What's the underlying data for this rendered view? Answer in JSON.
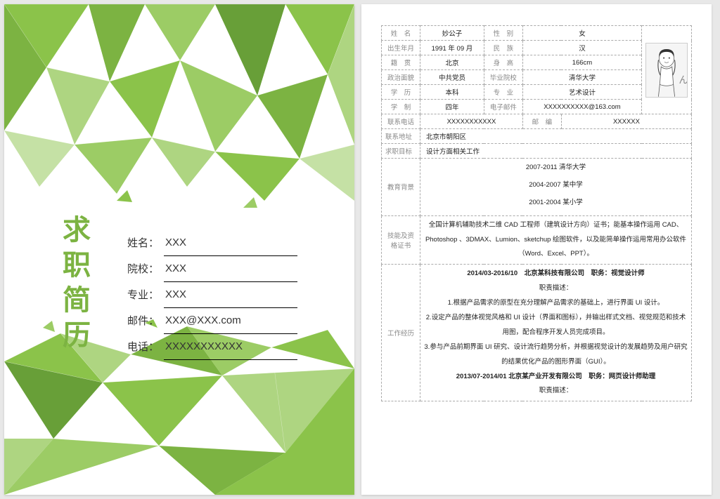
{
  "cover": {
    "title": "求职简历",
    "fields": [
      {
        "label": "姓名：",
        "value": "XXX"
      },
      {
        "label": "院校：",
        "value": "XXX"
      },
      {
        "label": "专业：",
        "value": "XXX"
      },
      {
        "label": "邮件：",
        "value": "XXX@XXX.com"
      },
      {
        "label": "电话：",
        "value": "XXXXXXXXXXX"
      }
    ]
  },
  "resume": {
    "basic": {
      "name_lbl": "姓　名",
      "name": "妙公子",
      "gender_lbl": "性　别",
      "gender": "女",
      "birth_lbl": "出生年月",
      "birth": "1991 年 09 月",
      "ethnic_lbl": "民　族",
      "ethnic": "汉",
      "origin_lbl": "籍　贯",
      "origin": "北京",
      "height_lbl": "身　高",
      "height": "166cm",
      "politics_lbl": "政治面貌",
      "politics": "中共党员",
      "school_lbl": "毕业院校",
      "school": "清华大学",
      "degree_lbl": "学　历",
      "degree": "本科",
      "major_lbl": "专　业",
      "major": "艺术设计",
      "years_lbl": "学　制",
      "years": "四年",
      "email_lbl": "电子邮件",
      "email": "XXXXXXXXXX@163.com",
      "phone_lbl": "联系电话",
      "phone": "XXXXXXXXXXX",
      "post_lbl": "邮　编",
      "post": "XXXXXX",
      "addr_lbl": "联系地址",
      "addr": "北京市朝阳区"
    },
    "objective": {
      "lbl": "求职目标",
      "value": "设计方面相关工作"
    },
    "education": {
      "lbl": "教育背景",
      "items": [
        "2007-2011 清华大学",
        "2004-2007 某中学",
        "2001-2004 某小学"
      ]
    },
    "skills": {
      "lbl1": "技能及资",
      "lbl2": "格证书",
      "value": "全国计算机辅助技术二维 CAD 工程师（建筑设计方向）证书；能基本操作运用 CAD、Photoshop 、3DMAX、Lumion、sketchup 绘图软件，以及能简单操作运用常用办公软件（Word、Excel、PPT）。"
    },
    "work": {
      "lbl": "工作经历",
      "job1_head": "2014/03-2016/10　北京某科技有限公司　职务：视觉设计师",
      "job1_duty_lbl": "职责描述：",
      "job1_bullets": [
        "1.根据产品需求的原型在充分理解产品需求的基础上，进行界面 UI 设计。",
        "2.设定产品的整体视觉风格和 UI 设计（界面和图标），并输出样式文档、视觉规范和技术用图，配合程序开发人员完成项目。",
        "3.参与产品前期界面 UI 研究、设计流行趋势分析，并根据视觉设计的发展趋势及用户研究的结果优化产品的图形界面（GUI）。"
      ],
      "job2_head": "2013/07-2014/01 北京某产业开发有限公司　职务：网页设计师助理",
      "job2_duty_lbl": "职责描述："
    }
  }
}
